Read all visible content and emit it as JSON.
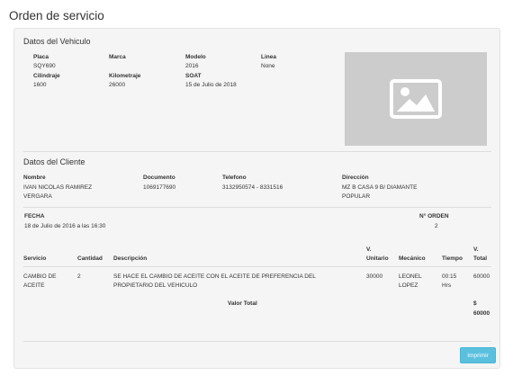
{
  "page_title": "Orden de servicio",
  "vehicle": {
    "section_title": "Datos del Vehiculo",
    "placa_label": "Placa",
    "placa": "SQY690",
    "marca_label": "Marca",
    "marca": "",
    "modelo_label": "Modelo",
    "modelo": "2016",
    "linea_label": "Linea",
    "linea": "None",
    "cilindraje_label": "Cilindraje",
    "cilindraje": "1600",
    "kilometraje_label": "Kilometraje",
    "kilometraje": "26000",
    "soat_label": "SOAT",
    "soat": "15 de Julio de 2018",
    "photo_icon": "image-placeholder-icon"
  },
  "client": {
    "section_title": "Datos del Cliente",
    "nombre_label": "Nombre",
    "nombre_line1": "IVAN NICOLAS RAMIREZ",
    "nombre_line2": "VERGARA",
    "documento_label": "Documento",
    "documento": "1069177690",
    "telefono_label": "Telefono",
    "telefono": "3132950574 - 8331516",
    "direccion_label": "Dirección",
    "direccion_line1": "MZ B CASA 9 B/ DIAMANTE",
    "direccion_line2": "POPULAR"
  },
  "order": {
    "fecha_label": "FECHA",
    "fecha": "18 de Julio de 2016 a las 16:30",
    "orden_label": "N° ORDEN",
    "orden": "2"
  },
  "table": {
    "headers": {
      "servicio": "Servicio",
      "cantidad": "Cantidad",
      "descripcion": "Descripción",
      "unitario_1": "V.",
      "unitario_2": "Unitario",
      "mecanico": "Mecánico",
      "tiempo": "Tiempo",
      "total_1": "V.",
      "total_2": "Total"
    },
    "rows": [
      {
        "servicio_1": "CAMBIO DE",
        "servicio_2": "ACEITE",
        "cantidad": "2",
        "descripcion_1": "SE HACE EL CAMBIO DE ACEITE CON EL ACEITE DE PREFERENCIA DEL",
        "descripcion_2": "PROPIETARIO DEL VEHICULO",
        "unitario": "30000",
        "mecanico_1": "LEONEL",
        "mecanico_2": "LOPEZ",
        "tiempo_1": "00:15",
        "tiempo_2": "Hrs",
        "total": "60000"
      }
    ],
    "valor_total_label": "Valor Total",
    "valor_total_currency": "$",
    "valor_total": "60000"
  },
  "actions": {
    "print_label": "Imprimir"
  }
}
